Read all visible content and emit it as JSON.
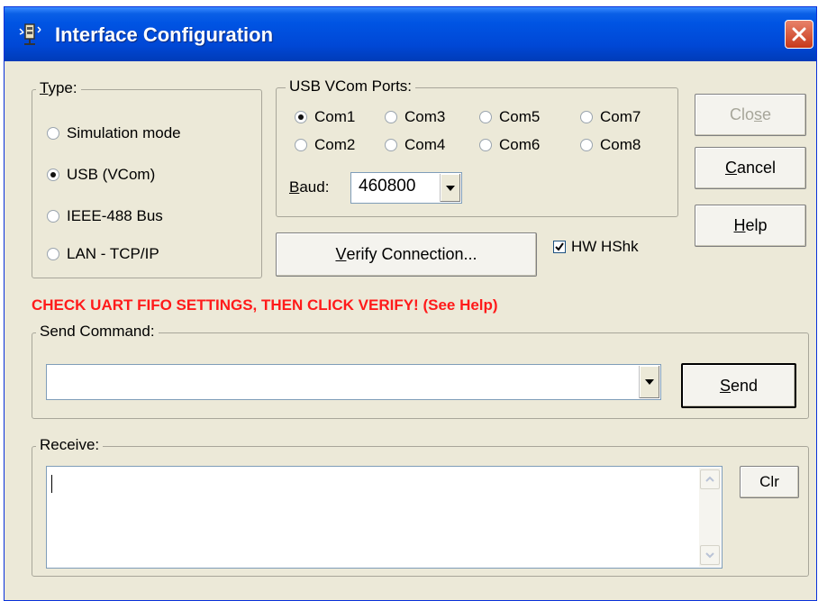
{
  "window": {
    "title": "Interface Configuration"
  },
  "type_group": {
    "legend": "Type:",
    "options": [
      {
        "label": "Simulation mode",
        "selected": false
      },
      {
        "label": "USB (VCom)",
        "selected": true
      },
      {
        "label": "IEEE-488 Bus",
        "selected": false
      },
      {
        "label": "LAN - TCP/IP",
        "selected": false
      }
    ]
  },
  "usb_group": {
    "legend": "USB VCom Ports:",
    "ports": [
      {
        "label": "Com1",
        "selected": true
      },
      {
        "label": "Com3",
        "selected": false
      },
      {
        "label": "Com5",
        "selected": false
      },
      {
        "label": "Com7",
        "selected": false
      },
      {
        "label": "Com2",
        "selected": false
      },
      {
        "label": "Com4",
        "selected": false
      },
      {
        "label": "Com6",
        "selected": false
      },
      {
        "label": "Com8",
        "selected": false
      }
    ],
    "baud_label": "Baud:",
    "baud_value": "460800"
  },
  "buttons": {
    "close": "Close",
    "cancel": "Cancel",
    "help": "Help",
    "verify": "Verify Connection...",
    "send": "Send",
    "clr": "Clr"
  },
  "hw_handshake": {
    "label": "HW HShk",
    "checked": true
  },
  "warning": "CHECK UART FIFO SETTINGS, THEN CLICK VERIFY! (See Help)",
  "send_group": {
    "legend": "Send Command:",
    "value": ""
  },
  "receive_group": {
    "legend": "Receive:",
    "value": ""
  },
  "colors": {
    "title_bar": "#0054e3",
    "warning": "#ff1a1a",
    "background": "#ece9d8"
  }
}
